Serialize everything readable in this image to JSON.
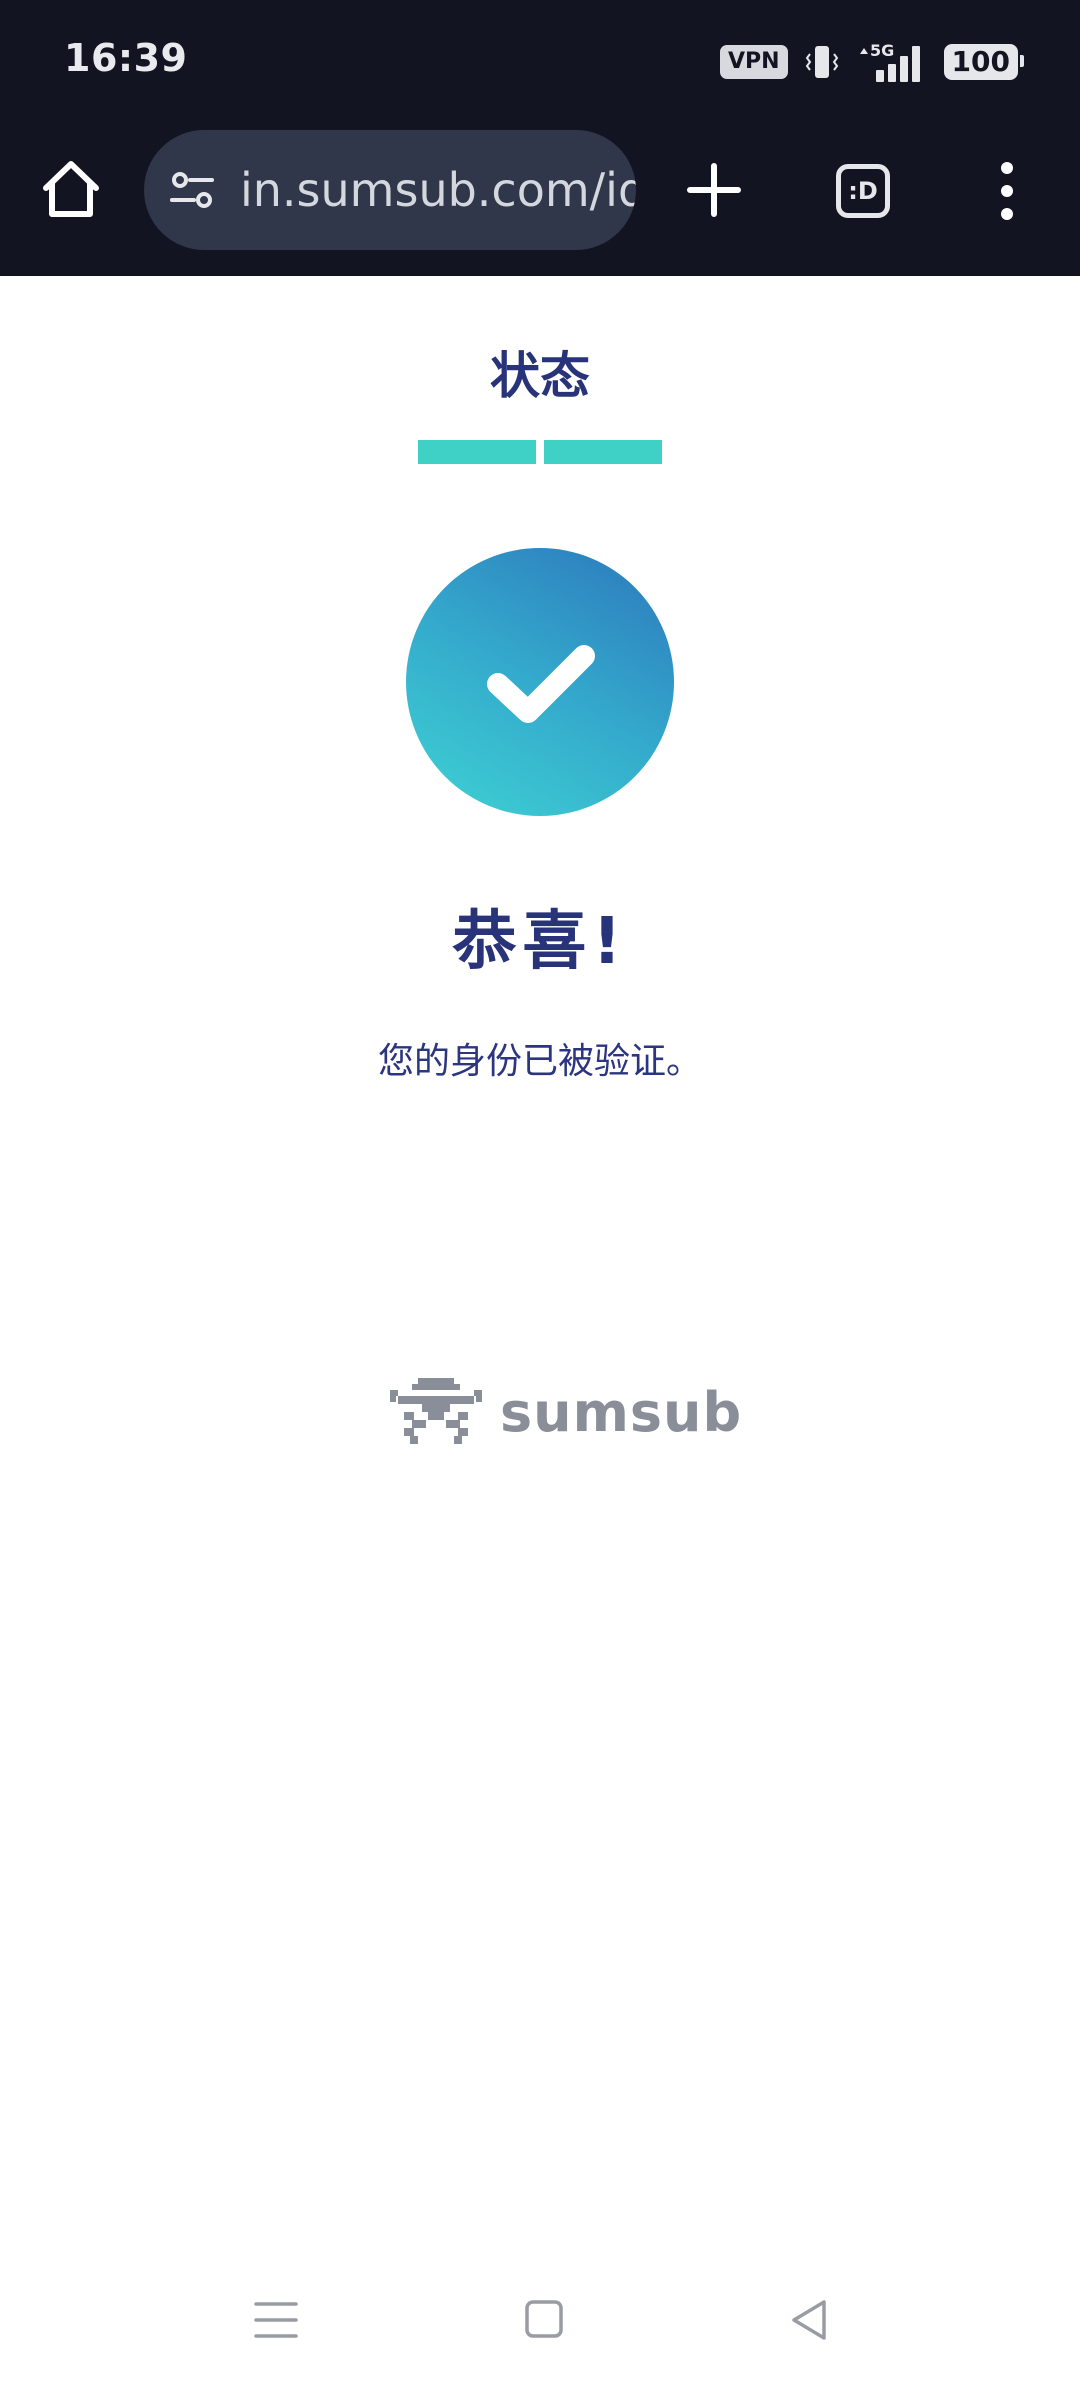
{
  "status_bar": {
    "time": "16:39",
    "vpn": "VPN",
    "network": "5G",
    "battery": "100",
    "icons": [
      "vibrate-icon",
      "signal-icon"
    ]
  },
  "browser": {
    "url": "in.sumsub.com/id",
    "tab_count": ":D",
    "icons": [
      "home-icon",
      "site-settings-icon",
      "new-tab-icon",
      "tab-switcher-icon",
      "overflow-menu-icon"
    ]
  },
  "page": {
    "heading": "状态",
    "progress_steps": 2,
    "progress_completed": 2,
    "title": "恭喜!",
    "message": "您的身份已被验证。",
    "brand": "sumsub",
    "colors": {
      "heading": "#28337a",
      "progress": "#3fd0c6",
      "circle_start": "#3ed3d4",
      "circle_end": "#2c77bc",
      "brand_gray": "#8a8e99"
    }
  },
  "system_nav": {
    "icons": [
      "recents-icon",
      "home-square-icon",
      "back-triangle-icon"
    ]
  }
}
